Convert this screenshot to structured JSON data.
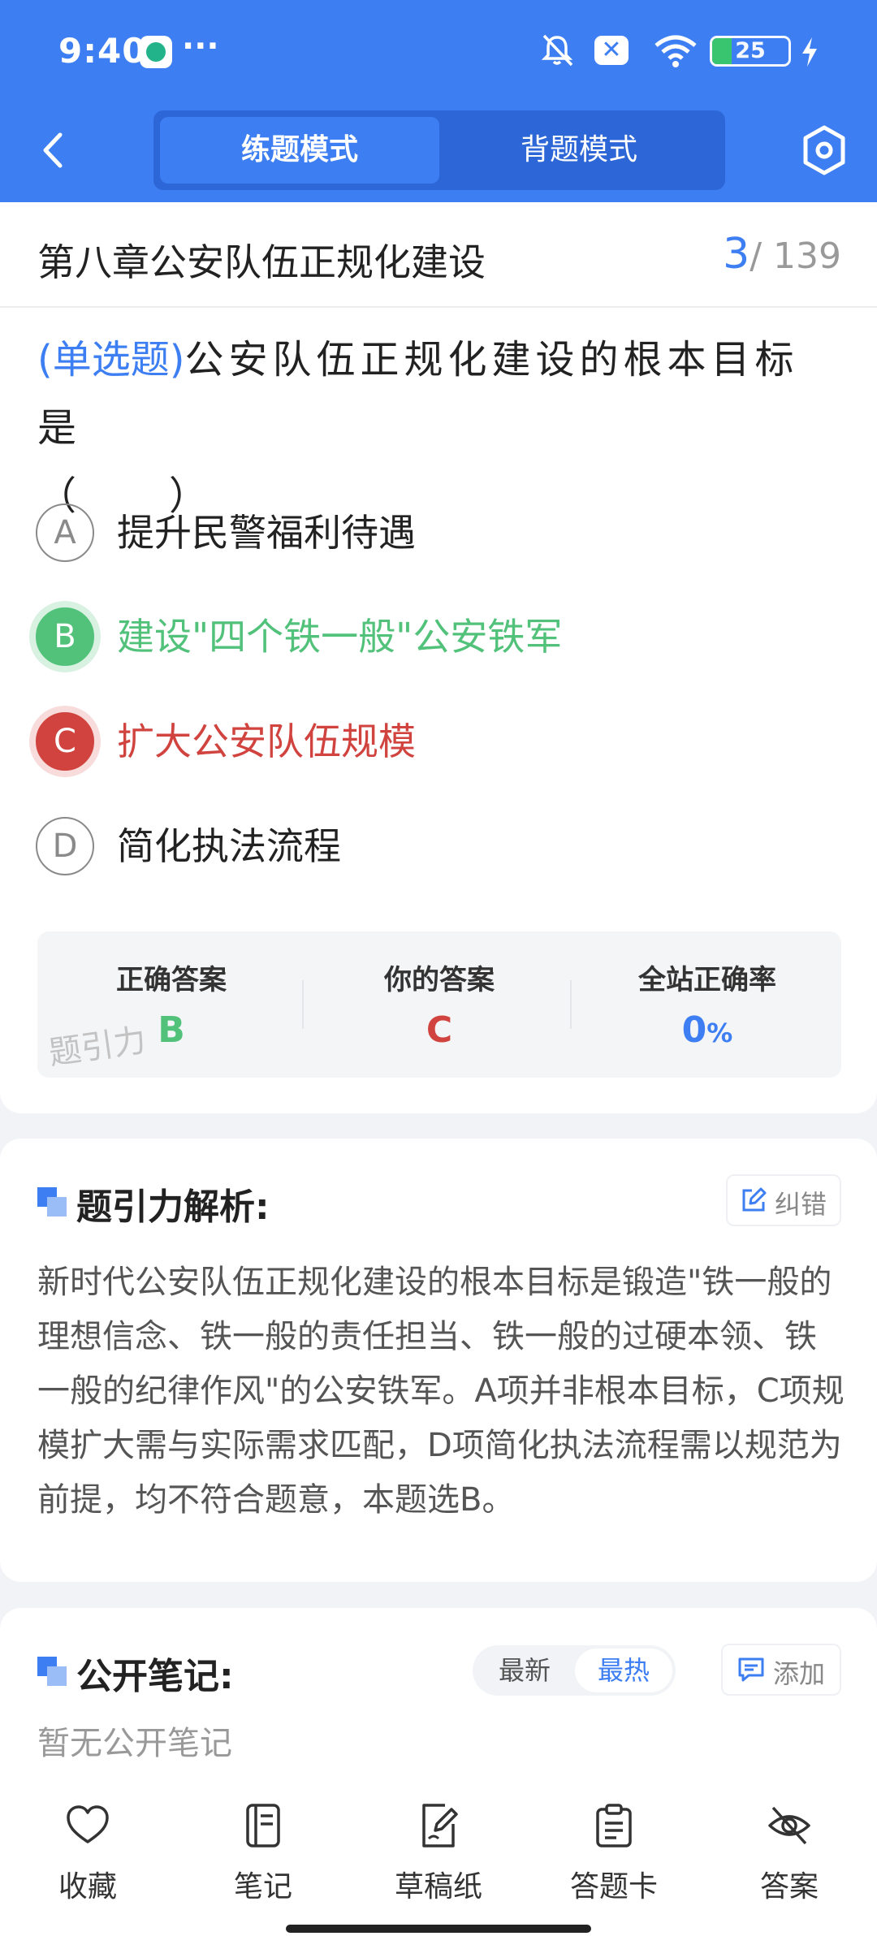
{
  "status_bar": {
    "time": "9:40",
    "more": "···",
    "battery_level": 25,
    "battery_text": "25",
    "x_badge": "✕"
  },
  "header": {
    "mode_tabs": [
      {
        "label": "练题模式",
        "active": true
      },
      {
        "label": "背题模式",
        "active": false
      }
    ],
    "accent_color": "#3d7ef2"
  },
  "chapter": {
    "title": "第八章公安队伍正规化建设",
    "current": "3",
    "total": "/ 139"
  },
  "question": {
    "type": "(单选题)",
    "stem": "公安队伍正规化建设的根本目标是",
    "blank": "（　　）"
  },
  "options": [
    {
      "letter": "A",
      "text": "提升民警福利待遇",
      "state": "normal"
    },
    {
      "letter": "B",
      "text": "建设\"四个铁一般\"公安铁军",
      "state": "correct"
    },
    {
      "letter": "C",
      "text": "扩大公安队伍规模",
      "state": "wrong"
    },
    {
      "letter": "D",
      "text": "简化执法流程",
      "state": "normal"
    }
  ],
  "result": {
    "correct_label": "正确答案",
    "correct_value": "B",
    "yours_label": "你的答案",
    "yours_value": "C",
    "rate_label": "全站正确率",
    "rate_value": "0",
    "rate_unit": "%",
    "watermark": "题引力",
    "correct_color": "#52c27b",
    "wrong_color": "#d0433e"
  },
  "analysis": {
    "title": "题引力解析:",
    "report_label": "纠错",
    "text": "新时代公安队伍正规化建设的根本目标是锻造\"铁一般的理想信念、铁一般的责任担当、铁一般的过硬本领、铁一般的纪律作风\"的公安铁军。A项并非根本目标，C项规模扩大需与实际需求匹配，D项简化执法流程需以规范为前提，均不符合题意，本题选B。"
  },
  "notes": {
    "title": "公开笔记:",
    "sort_latest": "最新",
    "sort_hot": "最热",
    "add_label": "添加",
    "empty_text": "暂无公开笔记"
  },
  "bottom_nav": [
    {
      "label": "收藏",
      "icon": "heart-icon"
    },
    {
      "label": "笔记",
      "icon": "notebook-icon"
    },
    {
      "label": "草稿纸",
      "icon": "draft-paper-icon"
    },
    {
      "label": "答题卡",
      "icon": "clipboard-icon"
    },
    {
      "label": "答案",
      "icon": "eye-off-icon"
    }
  ]
}
